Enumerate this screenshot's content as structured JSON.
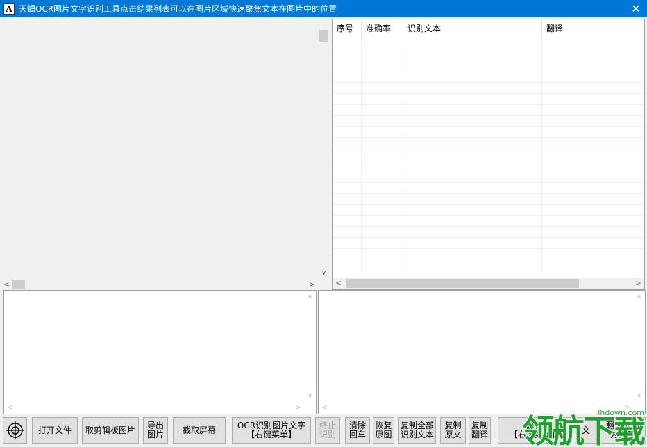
{
  "window": {
    "title": "天蝎OCR图片文字识别工具点击结果列表可以在图片区域快速聚焦文本在图片中的位置",
    "icon_letter": "A",
    "close_glyph": "✕"
  },
  "results_list": {
    "columns": [
      "序号",
      "准确率",
      "识别文本",
      "翻译"
    ],
    "rows": []
  },
  "toolbar": {
    "target_icon": "crosshair-target-icon",
    "open_file": "打开文件",
    "clipboard_image": "取剪辑板图片",
    "export_image": "导出\n图片",
    "capture_screen": "截取屏幕",
    "ocr": "OCR识别图片文字\n【右键菜单】",
    "stop": "终止\n识别",
    "clear_newline": "清除\n回车",
    "restore_image": "恢复\n原图",
    "copy_all": "复制全部\n识别文本",
    "copy_original": "复制\n原文",
    "copy_translation": "复制\n翻译",
    "translate": "翻译\n【右键菜单】",
    "partial_a": "文",
    "partial_b": "翻译强制\n为强制"
  },
  "watermark": {
    "text": "领航下载",
    "url": "lhdown.com"
  },
  "colors": {
    "titlebar": "#0078d7",
    "watermark": "#1fa22d"
  }
}
